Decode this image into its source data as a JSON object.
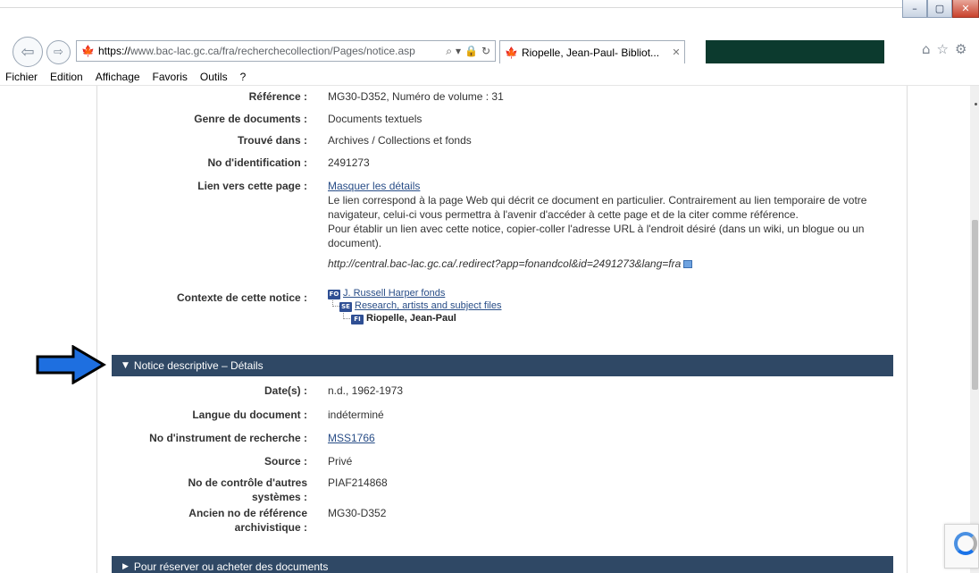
{
  "browser": {
    "window_buttons": {
      "minimize": "–",
      "maximize": "▢",
      "close": "✕"
    },
    "nav": {
      "back": "⇦",
      "forward": "⇨"
    },
    "address": {
      "scheme": "https://",
      "url_rest": "www.bac-lac.gc.ca/fra/recherchecollection/Pages/notice.asp",
      "icons": [
        "search-icon",
        "dropdown-icon",
        "lock-icon",
        "refresh-icon"
      ]
    },
    "tab": {
      "title": "Riopelle, Jean-Paul- Bibliot...",
      "close": "✕"
    },
    "right_icons": [
      "home-icon",
      "star-icon",
      "gear-icon"
    ]
  },
  "menubar": {
    "items": [
      "Fichier",
      "Edition",
      "Affichage",
      "Favoris",
      "Outils",
      "?"
    ]
  },
  "record": {
    "fields": [
      {
        "label": "Référence :",
        "value": "MG30-D352, Numéro de volume : 31"
      },
      {
        "label": "Genre de documents :",
        "value": "Documents textuels"
      },
      {
        "label": "Trouvé dans :",
        "value": "Archives / Collections et fonds"
      },
      {
        "label": "No d'identification :",
        "value": "2491273"
      }
    ],
    "link_field": {
      "label": "Lien vers cette page :",
      "toggle": "Masquer les détails",
      "paragraph_1": "Le lien correspond à la page Web qui décrit ce document en particulier. Contrairement au lien temporaire de votre navigateur, celui-ci vous permettra à l'avenir d'accéder à cette page et de la citer comme référence.",
      "paragraph_2": "Pour établir un lien avec cette notice, copier-coller l'adresse URL à l'endroit désiré (dans un wiki, un blogue ou un document).",
      "permalink": "http://central.bac-lac.gc.ca/.redirect?app=fonandcol&id=2491273&lang=fra"
    },
    "context": {
      "label": "Contexte de cette notice :",
      "tree": [
        {
          "badge": "FO",
          "text": "J. Russell Harper fonds"
        },
        {
          "badge": "SE",
          "text": "Research, artists and subject files"
        },
        {
          "badge": "FI",
          "text": "Riopelle, Jean-Paul"
        }
      ]
    }
  },
  "details_section": {
    "title": "Notice descriptive – Détails",
    "chevron": "▼",
    "fields": [
      {
        "label": "Date(s) :",
        "value": "n.d., 1962-1973"
      },
      {
        "label": "Langue du document :",
        "value": "indéterminé"
      },
      {
        "label": "No d'instrument de recherche :",
        "value": "MSS1766"
      },
      {
        "label": "Source :",
        "value": "Privé"
      },
      {
        "label": "No de contrôle d'autres systèmes :",
        "value": "PIAF214868"
      },
      {
        "label": "Ancien no de référence archivistique :",
        "value": "MG30-D352"
      }
    ]
  },
  "order_section": {
    "title": "Pour réserver ou acheter des documents",
    "chevron": "▶"
  },
  "colors": {
    "section_bar": "#2f4865",
    "link": "#284d87",
    "arrow_fill": "#1e6fe0",
    "maple": "#d52b1e",
    "tab_dark": "#0c3a2e"
  }
}
